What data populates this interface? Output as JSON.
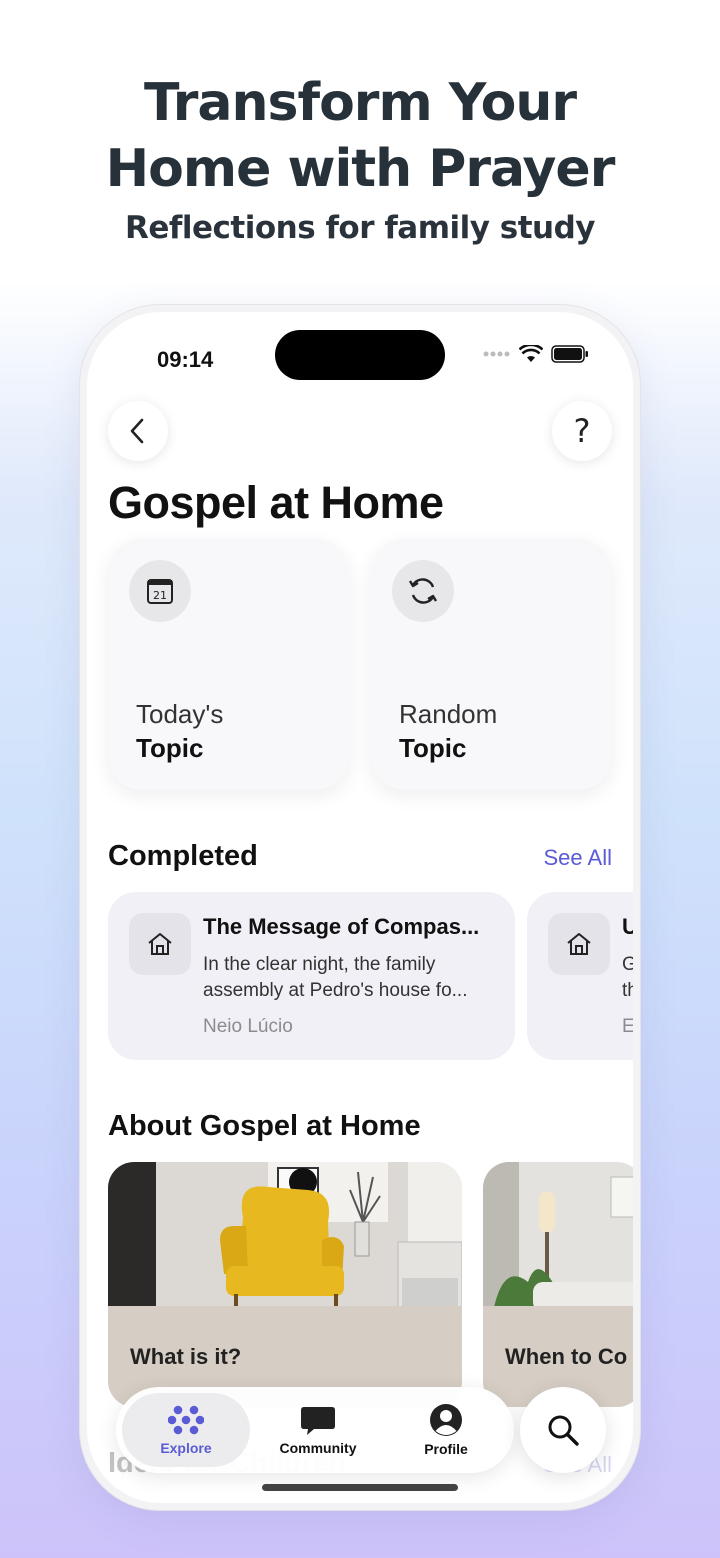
{
  "promo": {
    "headline_line1": "Transform Your",
    "headline_line2": "Home with Prayer",
    "subheadline": "Reflections for family study"
  },
  "status_bar": {
    "time": "09:14"
  },
  "header": {
    "back_icon": "chevron-left-icon",
    "help_label": "?"
  },
  "page": {
    "title": "Gospel at Home"
  },
  "topic_cards": [
    {
      "line1": "Today's",
      "line2": "Topic",
      "icon": "calendar-icon",
      "icon_text": "21"
    },
    {
      "line1": "Random",
      "line2": "Topic",
      "icon": "shuffle-icon"
    }
  ],
  "completed": {
    "title": "Completed",
    "see_all": "See All",
    "items": [
      {
        "title": "The Message of Compas...",
        "excerpt": "In the clear night, the family assembly at Pedro's house fo...",
        "author": "Neio Lúcio",
        "icon": "house-icon"
      },
      {
        "title": "U",
        "excerpt": "G th",
        "author": "E",
        "icon": "house-icon"
      }
    ]
  },
  "about": {
    "title": "About Gospel at Home",
    "cards": [
      {
        "label": "What is it?"
      },
      {
        "label": "When to Co"
      }
    ]
  },
  "next_section": {
    "title": "Ideal for Children",
    "see_all": "See All"
  },
  "tabbar": {
    "tabs": [
      {
        "label": "Explore",
        "icon": "explore-icon",
        "active": true
      },
      {
        "label": "Community",
        "icon": "chat-bubble-icon",
        "active": false
      },
      {
        "label": "Profile",
        "icon": "person-icon",
        "active": false
      }
    ],
    "search_icon": "search-icon"
  },
  "colors": {
    "accent": "#5b5bd6",
    "headline": "#26313a",
    "chair": "#e8b820"
  }
}
